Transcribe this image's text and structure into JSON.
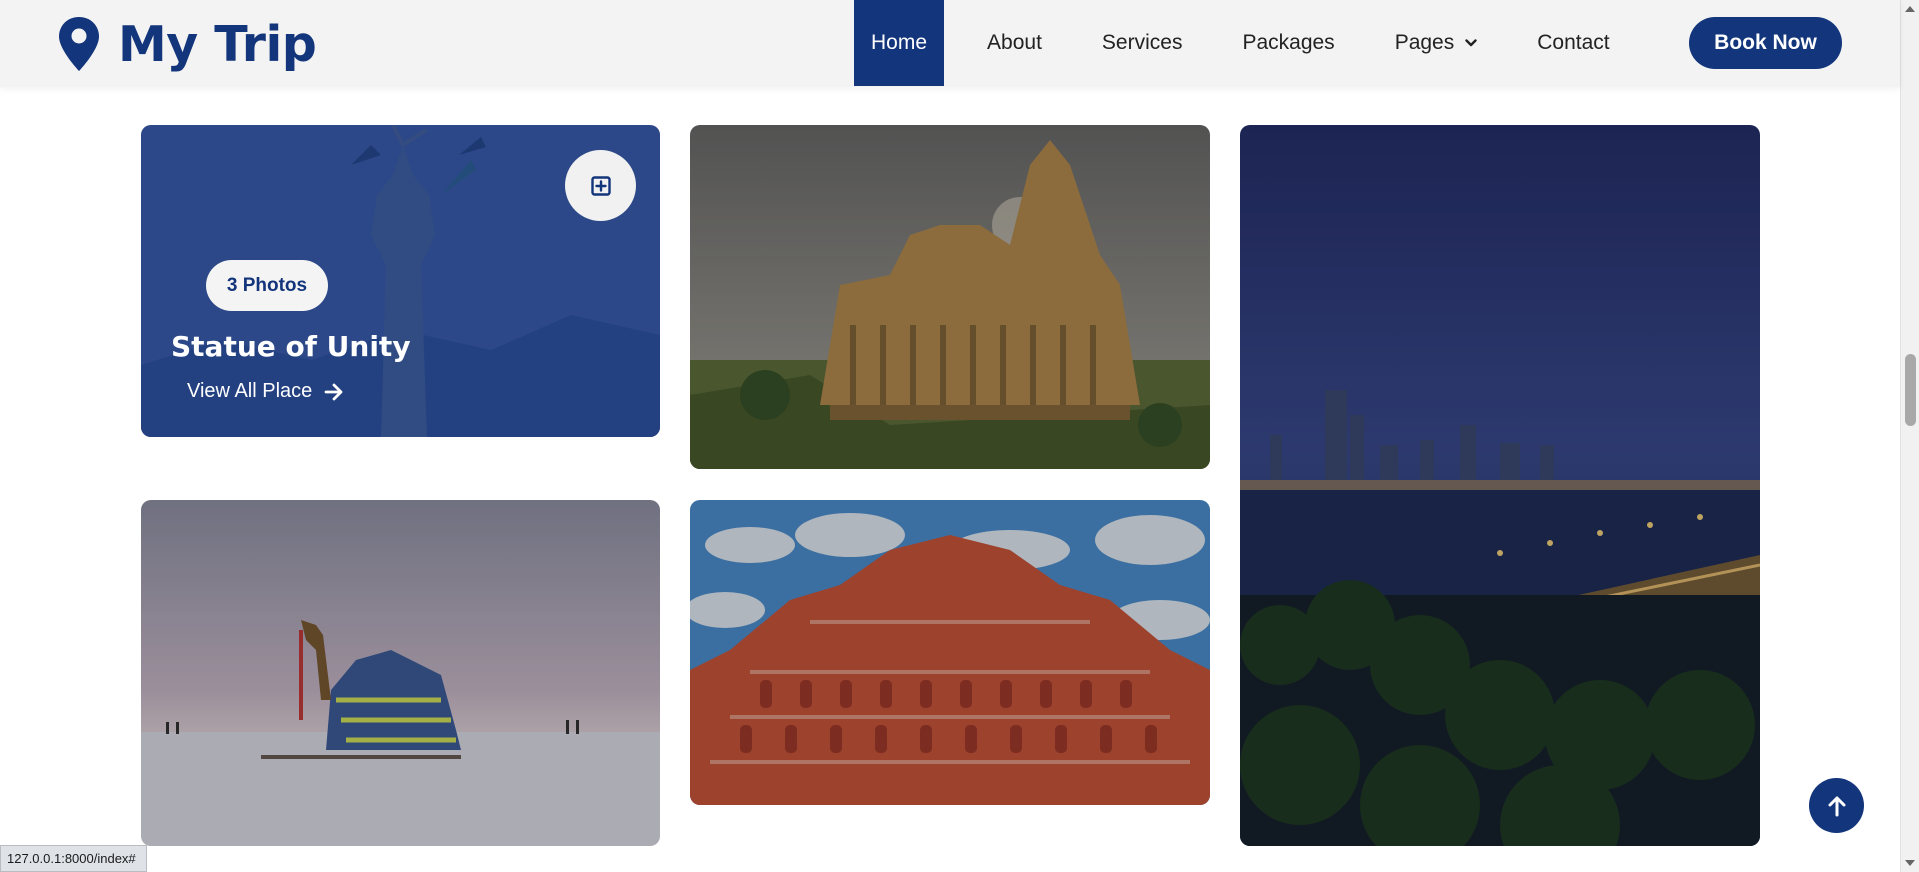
{
  "brand": {
    "name": "My Trip",
    "icon": "map-pin-icon",
    "color": "#13357b"
  },
  "nav": {
    "items": [
      {
        "label": "Home",
        "active": true
      },
      {
        "label": "About"
      },
      {
        "label": "Services"
      },
      {
        "label": "Packages"
      },
      {
        "label": "Pages",
        "dropdown": true
      },
      {
        "label": "Contact"
      }
    ],
    "cta_label": "Book Now"
  },
  "gallery": {
    "featured": {
      "badge": "3 Photos",
      "title": "Statue of Unity",
      "link_label": "View All Place",
      "expand_icon": "plus-square-icon",
      "link_icon": "arrow-right-icon"
    }
  },
  "scroll_top_icon": "arrow-up-icon",
  "status_url": "127.0.0.1:8000/index#",
  "colors": {
    "primary": "#13357b",
    "nav_bg": "#f3f3f3",
    "overlay": "rgba(19,53,123,0.72)"
  }
}
